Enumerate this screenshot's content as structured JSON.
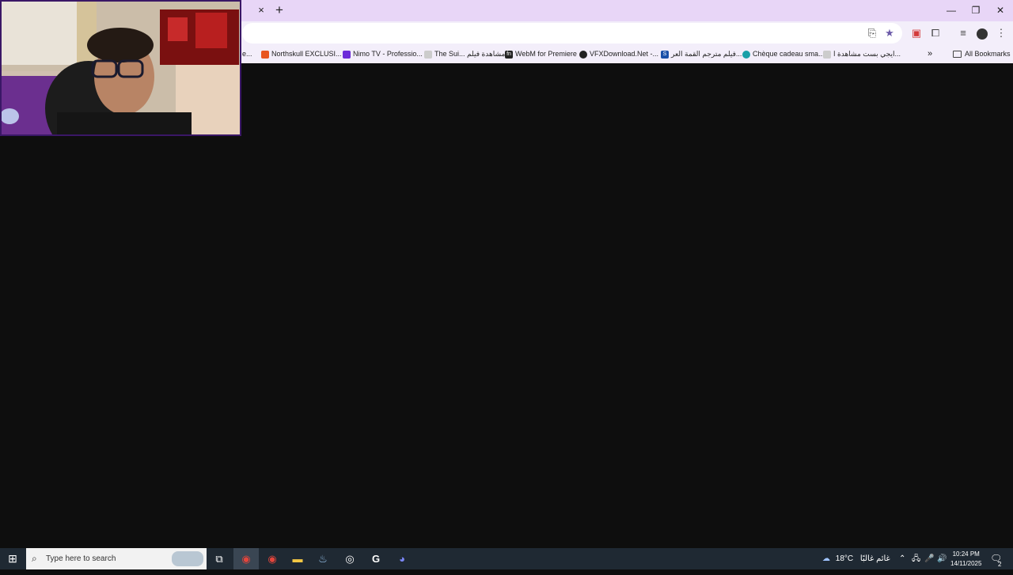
{
  "browser": {
    "tab_close_glyph": "×",
    "new_tab_glyph": "+",
    "window_controls": {
      "minimize": "—",
      "restore": "❐",
      "close": "✕"
    }
  },
  "bookmarks": {
    "items": [
      {
        "label": "e...",
        "icon": "page-icon",
        "color": "#999999"
      },
      {
        "label": "Northskull EXCLUSI...",
        "icon": "fire-icon",
        "color": "#e8561f"
      },
      {
        "label": "Nimo TV - Professio...",
        "icon": "nimo-icon",
        "color": "#6c2bd9"
      },
      {
        "label": "The Sui... مشاهدة فيلم",
        "icon": "page-icon",
        "color": "#bbbbbb"
      },
      {
        "label": "WebM for Premiere",
        "icon": "fn-icon",
        "color": "#222222"
      },
      {
        "label": "VFXDownload.Net -...",
        "icon": "vfx-icon",
        "color": "#222222"
      },
      {
        "label": "فيلم مترجم القمة العر...",
        "icon": "s-icon",
        "color": "#1a4fa8"
      },
      {
        "label": "Chèque cadeau sma...",
        "icon": "gift-icon",
        "color": "#19a0a8"
      },
      {
        "label": "ايجي بست مشاهدة ا...",
        "icon": "page-icon",
        "color": "#bbbbbb"
      }
    ],
    "more_glyph": "»",
    "all_bookmarks": "All Bookmarks"
  },
  "taskbar": {
    "search_placeholder": "Type here to search",
    "apps": [
      {
        "name": "task-view-icon",
        "glyph": "⧉"
      },
      {
        "name": "chrome-icon",
        "glyph": "◉",
        "color": "#e2453c"
      },
      {
        "name": "chrome-profile-icon",
        "glyph": "◉",
        "color": "#e2453c"
      },
      {
        "name": "file-explorer-icon",
        "glyph": "▬",
        "color": "#f2c744"
      },
      {
        "name": "steam-icon",
        "glyph": "♨",
        "color": "#9ac7f0"
      },
      {
        "name": "obs-icon",
        "glyph": "◎",
        "color": "#ffffff"
      },
      {
        "name": "g-hub-icon",
        "glyph": "G",
        "color": "#ffffff"
      },
      {
        "name": "discord-icon",
        "glyph": "◕",
        "color": "#7b87f7"
      }
    ],
    "weather": {
      "temp": "18°C",
      "desc": "غائم غالبًا"
    },
    "time": "10:24 PM",
    "date": "14/11/2025",
    "notification_count": "2"
  }
}
